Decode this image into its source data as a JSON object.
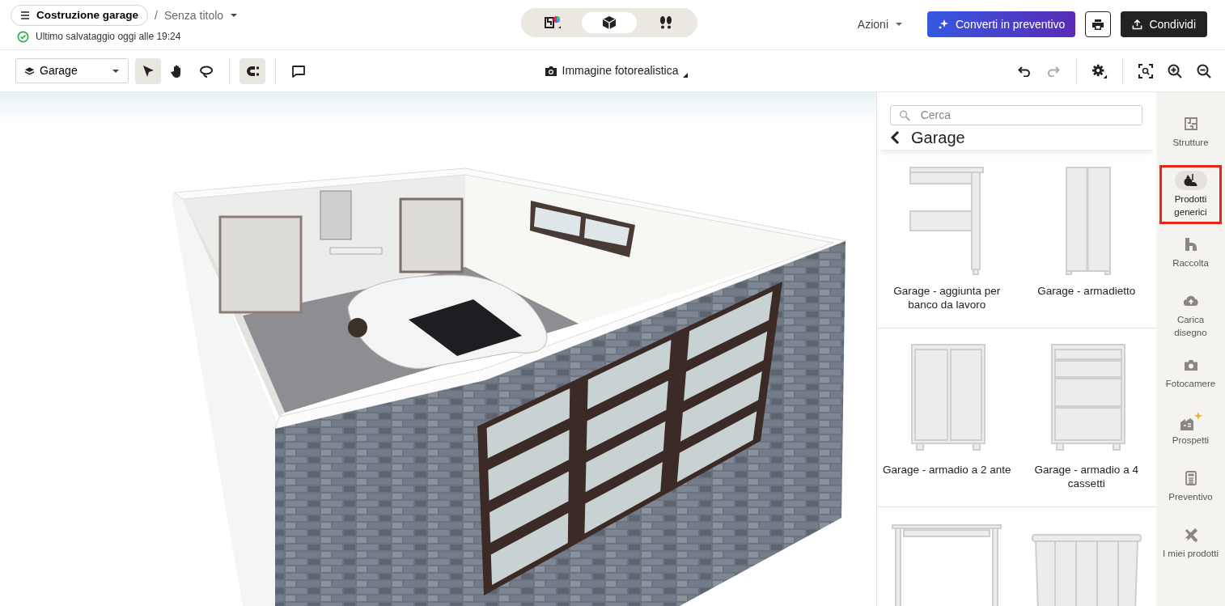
{
  "header": {
    "project_button": "Costruzione garage",
    "separator": "/",
    "design_name": "Senza titolo",
    "save_status": "Ultimo salvataggio oggi alle 19:24",
    "view_modes": [
      {
        "kind": "plan2d",
        "selected": false
      },
      {
        "kind": "view3d",
        "selected": true
      },
      {
        "kind": "walk",
        "selected": false
      }
    ],
    "actions_menu": "Azioni",
    "convert_button": "Converti in preventivo",
    "share_button": "Condividi"
  },
  "toolbar": {
    "level_select": "Garage",
    "tools": [
      {
        "kind": "select",
        "selected": true
      },
      {
        "kind": "pan",
        "selected": false
      },
      {
        "kind": "lasso",
        "selected": false
      }
    ],
    "snap": {
      "on": true
    },
    "photo_button": "Immagine fotorealistica",
    "undo_disabled": false,
    "redo_disabled": true
  },
  "panel": {
    "search": {
      "placeholder": "Cerca"
    },
    "title": "Garage",
    "products": [
      {
        "kind": "workbench",
        "name": "Garage - aggiunta per banco da lavoro"
      },
      {
        "kind": "tallcabinet",
        "name": "Garage - armadietto"
      },
      {
        "kind": "twodoor",
        "name": "Garage - armadio a 2 ante"
      },
      {
        "kind": "drawers",
        "name": "Garage - armadio a 4 cassetti"
      },
      {
        "kind": "table"
      },
      {
        "kind": "bins"
      }
    ]
  },
  "rail": [
    {
      "kind": "floorplan",
      "label": "Strutture",
      "selected": false,
      "highlighted": false
    },
    {
      "kind": "products",
      "label": "Prodotti generici",
      "selected": true,
      "highlighted": true
    },
    {
      "kind": "collection",
      "label": "Raccolta",
      "selected": false,
      "highlighted": false
    },
    {
      "kind": "upload",
      "label": "Carica disegno",
      "selected": false,
      "highlighted": false
    },
    {
      "kind": "camera",
      "label": "Fotocamere",
      "selected": false,
      "highlighted": false
    },
    {
      "kind": "elevations",
      "label": "Prospetti",
      "selected": false,
      "highlighted": false
    },
    {
      "kind": "calculator",
      "label": "Preventivo",
      "selected": false,
      "highlighted": false
    },
    {
      "kind": "tools",
      "label": "I miei prodotti",
      "selected": false,
      "highlighted": false
    }
  ]
}
